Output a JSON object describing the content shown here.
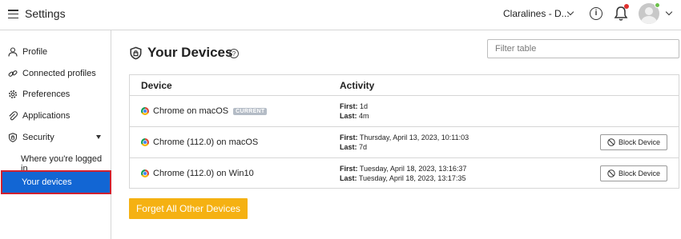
{
  "header": {
    "title": "Settings",
    "account_name": "Claralines - D...",
    "info_glyph": "i"
  },
  "sidebar": {
    "items": [
      {
        "label": "Profile",
        "icon": "person-icon"
      },
      {
        "label": "Connected profiles",
        "icon": "link-icon"
      },
      {
        "label": "Preferences",
        "icon": "gear-icon"
      },
      {
        "label": "Applications",
        "icon": "paperclip-icon"
      },
      {
        "label": "Security",
        "icon": "shield-icon"
      }
    ],
    "sub_items": [
      {
        "label": "Where you're logged in"
      },
      {
        "label": "Your devices",
        "active": true
      }
    ]
  },
  "main": {
    "title": "Your Devices",
    "help_glyph": "?",
    "filter_placeholder": "Filter table",
    "table": {
      "headers": [
        "Device",
        "Activity"
      ],
      "rows": [
        {
          "device": "Chrome on macOS",
          "badge": "CURRENT",
          "first_label": "First:",
          "first": "1d",
          "last_label": "Last:",
          "last": "4m",
          "button": ""
        },
        {
          "device": "Chrome (112.0) on macOS",
          "badge": "",
          "first_label": "First:",
          "first": "Thursday, April 13, 2023, 10:11:03",
          "last_label": "Last:",
          "last": "7d",
          "button": "Block Device"
        },
        {
          "device": "Chrome (112.0) on Win10",
          "badge": "",
          "first_label": "First:",
          "first": "Tuesday, April 18, 2023, 13:16:37",
          "last_label": "Last:",
          "last": "Tuesday, April 18, 2023, 13:17:35",
          "button": "Block Device"
        }
      ]
    },
    "forget_button": "Forget All Other Devices"
  },
  "colors": {
    "accent": "#1266d4",
    "active_outline": "#d0202f",
    "forget_button": "#f5b112",
    "notification": "#e0312f",
    "online": "#6cc04a"
  }
}
